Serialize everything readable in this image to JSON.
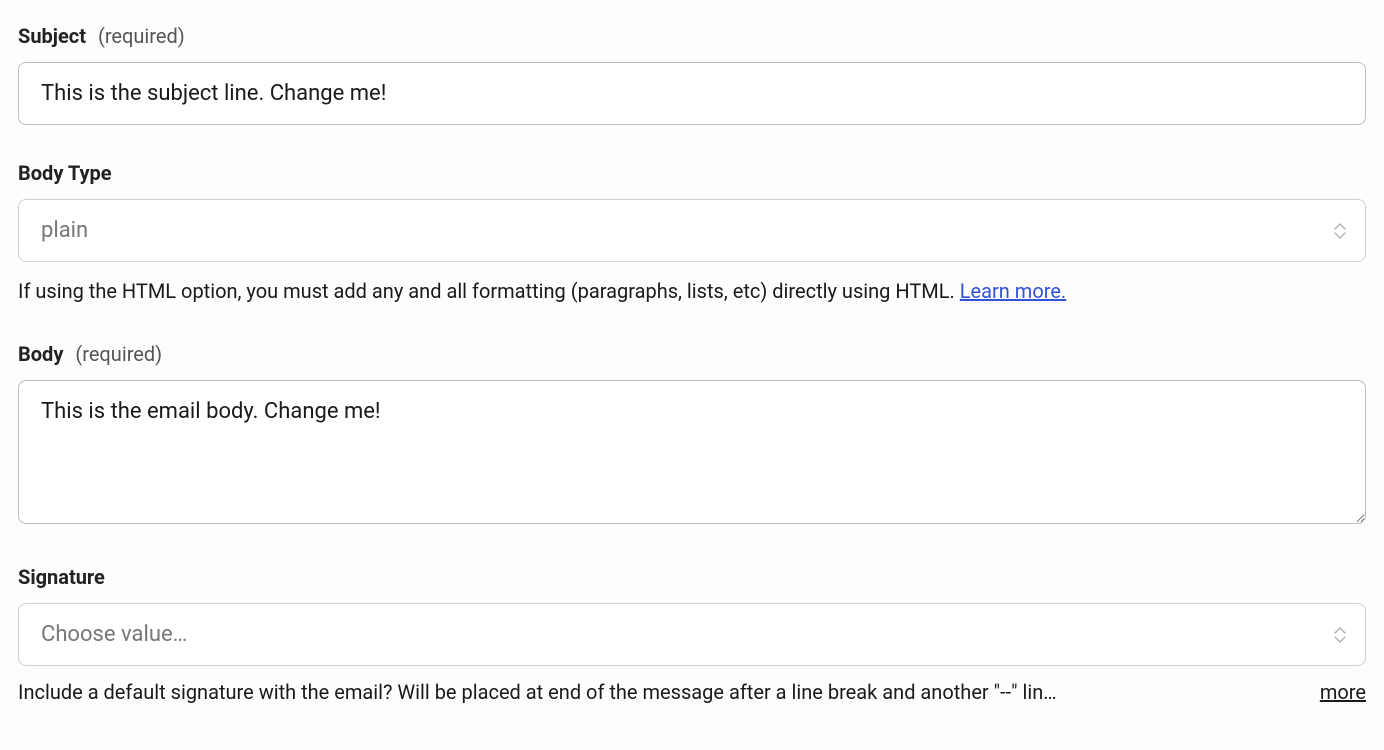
{
  "subject": {
    "label": "Subject",
    "required_hint": "(required)",
    "value": "This is the subject line. Change me!"
  },
  "body_type": {
    "label": "Body Type",
    "selected": "plain",
    "help_text": "If using the HTML option, you must add any and all formatting (paragraphs, lists, etc) directly using HTML. ",
    "help_link_text": "Learn more."
  },
  "body": {
    "label": "Body",
    "required_hint": "(required)",
    "value": "This is the email body. Change me!"
  },
  "signature": {
    "label": "Signature",
    "placeholder": "Choose value…",
    "help_text": "Include a default signature with the email? Will be placed at end of the message after a line break and another \"--\" lin…",
    "more_label": "more"
  }
}
